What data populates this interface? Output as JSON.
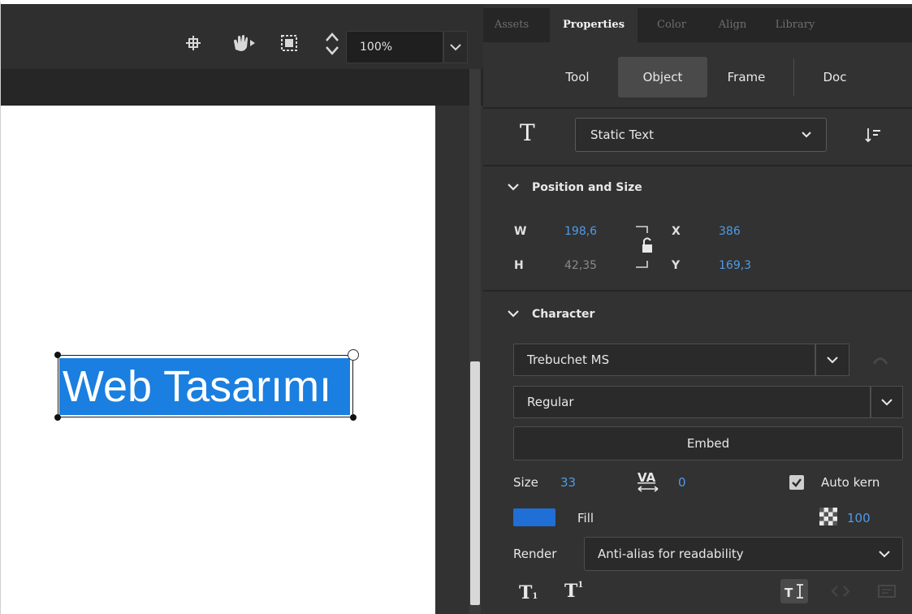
{
  "stage": {
    "zoom": "100%",
    "text_object": "Web Tasarımı",
    "toolbar_icons": [
      "snap-to-stage-icon",
      "hand-tool-icon",
      "clip-outside-stage-icon",
      "zoom-stepper-icon"
    ]
  },
  "panel": {
    "tabs": [
      {
        "label": "Assets",
        "active": false
      },
      {
        "label": "Properties",
        "active": true
      },
      {
        "label": "Color",
        "active": false
      },
      {
        "label": "Align",
        "active": false
      },
      {
        "label": "Library",
        "active": false
      }
    ],
    "sub_tabs": [
      {
        "label": "Tool",
        "active": false
      },
      {
        "label": "Object",
        "active": true
      },
      {
        "label": "Frame",
        "active": false
      },
      {
        "label": "Doc",
        "active": false
      }
    ],
    "text_type": "Static Text",
    "position_size": {
      "title": "Position and Size",
      "w_label": "W",
      "w_value": "198,6",
      "h_label": "H",
      "h_value": "42,35",
      "x_label": "X",
      "x_value": "386",
      "y_label": "Y",
      "y_value": "169,3"
    },
    "character": {
      "title": "Character",
      "font_family": "Trebuchet MS",
      "font_style": "Regular",
      "embed_label": "Embed",
      "size_label": "Size",
      "size_value": "33",
      "tracking_value": "0",
      "auto_kern_label": "Auto kern",
      "auto_kern_checked": true,
      "fill_label": "Fill",
      "fill_color": "#1f6fd6",
      "alpha_value": "100",
      "render_label": "Render",
      "render_value": "Anti-alias for readability",
      "subscript_label": "T",
      "superscript_label": "T"
    }
  },
  "colors": {
    "selection_fill": "#1a7fe0",
    "value_blue": "#4f9be8",
    "panel_bg": "#323232"
  }
}
